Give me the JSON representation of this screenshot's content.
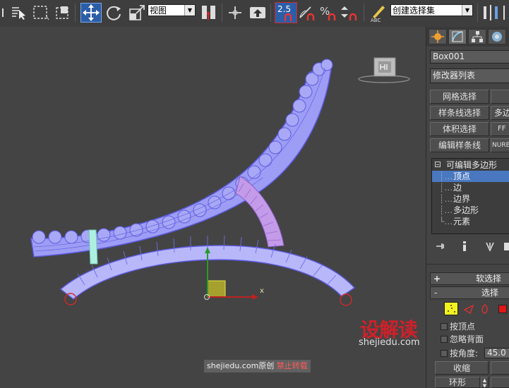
{
  "toolbar": {
    "view_dropdown": "视图",
    "snap_value": "2.5",
    "named_selection": "创建选择集"
  },
  "viewport": {
    "axis_x": "x"
  },
  "command_panel": {
    "object_name": "Box001",
    "modifier_list": "修改器列表",
    "buttons": [
      {
        "label": "网格选择"
      },
      {
        "label": "样条线选择"
      },
      {
        "label": "多边"
      },
      {
        "label": "体积选择"
      },
      {
        "label": "FF"
      },
      {
        "label": "编辑样条线"
      },
      {
        "label": "NURBS"
      }
    ],
    "stack": {
      "modifier": "可编辑多边形",
      "items": [
        "顶点",
        "边",
        "边界",
        "多边形",
        "元素"
      ],
      "selected_index": 0
    },
    "soft_selection": "软选择",
    "selection": "选择",
    "by_vertex": "按顶点",
    "ignore_backfacing": "忽略背面",
    "by_angle": "按角度:",
    "angle_value": "45.0",
    "shrink": "收缩",
    "ring": "环形"
  },
  "watermark": {
    "logo": "设解读",
    "url": "shejiedu.com",
    "footer_site": "shejiedu.com",
    "footer_original": "原创",
    "footer_forbid": "禁止转载"
  },
  "colors": {
    "ui_background": "#444444",
    "mesh_fill": "#9e9df5",
    "mesh_edge": "#5b5ae0",
    "selected_arc": "#c39be9",
    "stack_highlight": "#4a78c0",
    "brand_red": "#d0202a"
  }
}
